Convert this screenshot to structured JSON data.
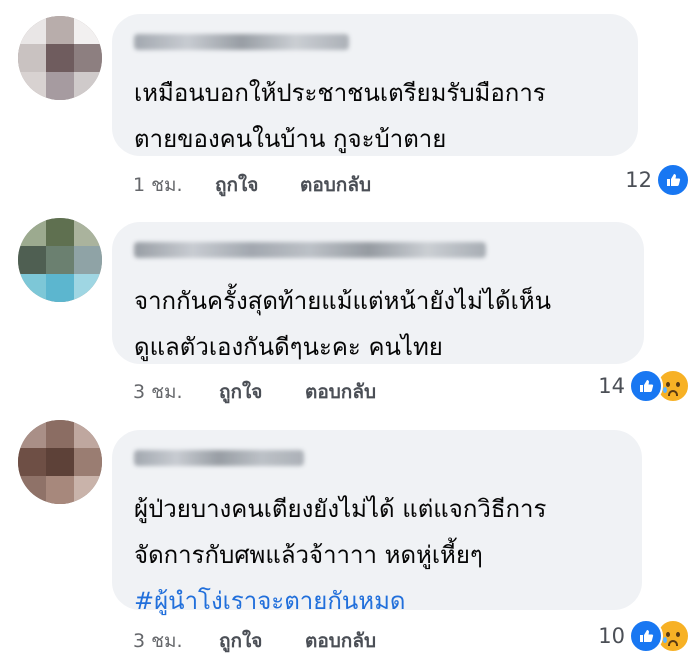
{
  "comments": [
    {
      "author": "",
      "lines": [
        "เหมือนบอกให้ประชาชนเตรียมรับมือการ",
        "ตายของคนในบ้าน กูจะบ้าตาย"
      ],
      "hashtag": "",
      "time": "1 ชม.",
      "like_label": "ถูกใจ",
      "reply_label": "ตอบกลับ",
      "reaction_count": "12",
      "reactions": [
        "like-icon"
      ]
    },
    {
      "author": "",
      "lines": [
        "จากกันครั้งสุดท้ายแม้แต่หน้ายังไม่ได้เห็น",
        "ดูแลตัวเองกันดีๆนะคะ คนไทย"
      ],
      "hashtag": "",
      "time": "3 ชม.",
      "like_label": "ถูกใจ",
      "reply_label": "ตอบกลับ",
      "reaction_count": "14",
      "reactions": [
        "like-icon",
        "sad-icon"
      ]
    },
    {
      "author": "",
      "lines": [
        "ผู้ป่วยบางคนเตียงยังไม่ได้ แต่แจกวิธีการ",
        "จัดการกับศพแล้วจ้าาาา หดหู่เหี้ยๆ"
      ],
      "hashtag": "#ผู้นำโง่เราจะตายกันหมด",
      "time": "3 ชม.",
      "like_label": "ถูกใจ",
      "reply_label": "ตอบกลับ",
      "reaction_count": "10",
      "reactions": [
        "like-icon",
        "sad-icon"
      ]
    }
  ],
  "colors": {
    "bubble": "#f0f2f5",
    "meta_text": "#65676b",
    "hashtag": "#216fdb",
    "like_blue": "#1877f2",
    "sad_yellow": "#f7b125"
  }
}
